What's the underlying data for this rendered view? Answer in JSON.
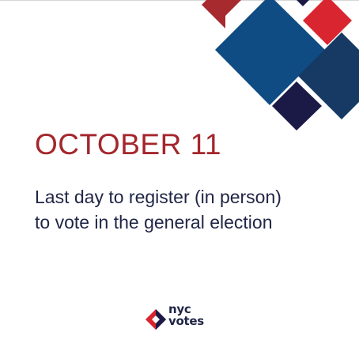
{
  "event": {
    "date": "OCTOBER 11",
    "message_lines": [
      "Last day to register (in person)",
      "to vote in the general election"
    ]
  },
  "brand": {
    "logo_line_1": "nyc",
    "logo_line_2": "votes"
  },
  "colors": {
    "accent_red": "#a4262c",
    "text_navy": "#1f2545",
    "tile_bright_red": "#d9252f",
    "tile_dark_red": "#a62a2e",
    "tile_blue": "#0f4c83",
    "tile_dark_blue": "#163a64",
    "tile_navy": "#1b1a47",
    "divider_gray": "#d6d6d6"
  },
  "icons": {
    "decoration": "diamond-tiles-graphic",
    "logo_mark": "nyc-votes-diamond-icon"
  }
}
